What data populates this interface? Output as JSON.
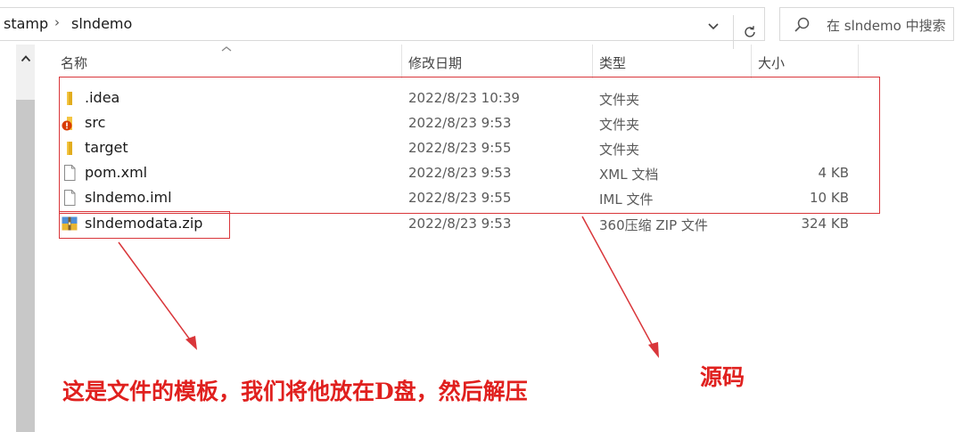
{
  "breadcrumb": {
    "items": [
      "stamp",
      "slndemo"
    ]
  },
  "search": {
    "placeholder": "在 slndemo 中搜索"
  },
  "columns": [
    "名称",
    "修改日期",
    "类型",
    "大小"
  ],
  "files": [
    {
      "name": ".idea",
      "date": "2022/8/23 10:39",
      "type": "文件夹",
      "size": "",
      "icon": "folder-icon"
    },
    {
      "name": "src",
      "date": "2022/8/23 9:53",
      "type": "文件夹",
      "size": "",
      "icon": "folder-error-icon"
    },
    {
      "name": "target",
      "date": "2022/8/23 9:55",
      "type": "文件夹",
      "size": "",
      "icon": "folder-icon"
    },
    {
      "name": "pom.xml",
      "date": "2022/8/23 9:53",
      "type": "XML 文档",
      "size": "4 KB",
      "icon": "document-icon"
    },
    {
      "name": "slndemo.iml",
      "date": "2022/8/23 9:55",
      "type": "IML 文件",
      "size": "10 KB",
      "icon": "document-icon"
    },
    {
      "name": "slndemodata.zip",
      "date": "2022/8/23 9:53",
      "type": "360压缩 ZIP 文件",
      "size": "324 KB",
      "icon": "zip-archive-icon"
    }
  ],
  "annotations": {
    "template_note": "这是文件的模板，我们将他放在D盘，然后解压",
    "source_note": "源码",
    "color": "#e0201e"
  },
  "colors": {
    "folder": "#f4c542",
    "error_badge": "#d83b01",
    "annotation": "#d9363a"
  }
}
